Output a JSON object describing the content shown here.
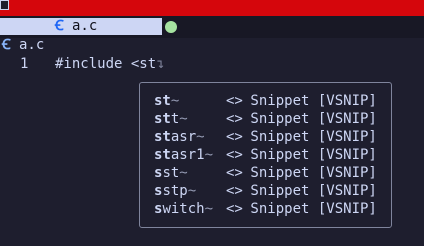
{
  "tabline": {
    "active_tab": {
      "icon": "c-file-icon",
      "label": "a.c"
    },
    "modified_indicator": "green-dot"
  },
  "winbar": {
    "icon": "c-file-icon",
    "filename": "a.c"
  },
  "editor": {
    "line_number": "1",
    "code_text": "#include <st",
    "cursor_marker": "↴"
  },
  "completion": {
    "items": [
      {
        "match": "st",
        "rest": "",
        "tilde": "~",
        "kind": "<>",
        "menu": "Snippet [VSNIP]"
      },
      {
        "match": "st",
        "rest": "t",
        "tilde": "~",
        "kind": "<>",
        "menu": "Snippet [VSNIP]"
      },
      {
        "match": "st",
        "rest": "asr",
        "tilde": "~",
        "kind": "<>",
        "menu": "Snippet [VSNIP]"
      },
      {
        "match": "st",
        "rest": "asr1",
        "tilde": "~",
        "kind": "<>",
        "menu": "Snippet [VSNIP]"
      },
      {
        "match": "s",
        "rest": "st",
        "tilde": "~",
        "kind": "<>",
        "menu": "Snippet [VSNIP]"
      },
      {
        "match": "s",
        "rest": "stp",
        "tilde": "~",
        "kind": "<>",
        "menu": "Snippet [VSNIP]"
      },
      {
        "match": "s",
        "rest": "witch",
        "tilde": "~",
        "kind": "<>",
        "menu": "Snippet [VSNIP]"
      }
    ]
  },
  "colors": {
    "top_bar": "#d5060c",
    "background": "#1e1e2e",
    "tab_bg": "#cdd6f4",
    "modified_dot": "#a6e3a1",
    "c_icon": "#89b4fa"
  }
}
